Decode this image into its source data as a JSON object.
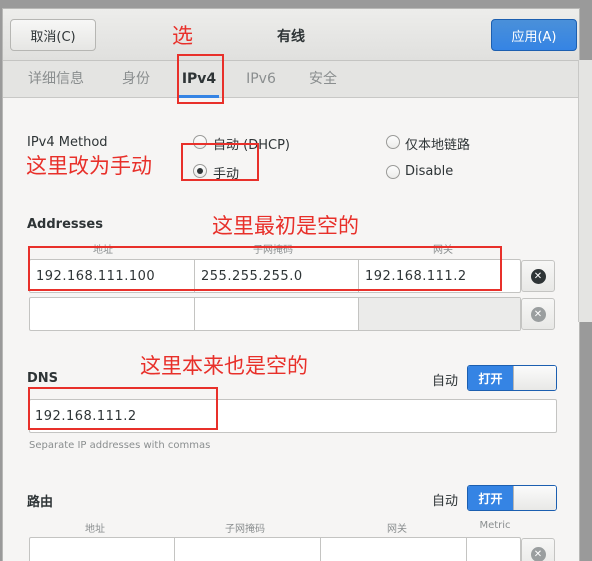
{
  "header": {
    "cancel_label": "取消(C)",
    "title": "有线",
    "apply_label": "应用(A)"
  },
  "tabs": [
    {
      "label": "详细信息"
    },
    {
      "label": "身份"
    },
    {
      "label": "IPv4"
    },
    {
      "label": "IPv6"
    },
    {
      "label": "安全"
    }
  ],
  "ipv4_method": {
    "label": "IPv4 Method",
    "options": [
      {
        "label": "自动 (DHCP)",
        "selected": false
      },
      {
        "label": "仅本地链路",
        "selected": false
      },
      {
        "label": "手动",
        "selected": true
      },
      {
        "label": "Disable",
        "selected": false
      }
    ]
  },
  "addresses": {
    "label": "Addresses",
    "columns": [
      "地址",
      "子网掩码",
      "网关"
    ],
    "rows": [
      {
        "address": "192.168.111.100",
        "netmask": "255.255.255.0",
        "gateway": "192.168.111.2"
      },
      {
        "address": "",
        "netmask": "",
        "gateway": ""
      }
    ]
  },
  "dns": {
    "label": "DNS",
    "auto_label": "自动",
    "toggle_label": "打开",
    "value": "192.168.111.2",
    "hint": "Separate IP addresses with commas"
  },
  "routes": {
    "label": "路由",
    "auto_label": "自动",
    "toggle_label": "打开",
    "columns": [
      "地址",
      "子网掩码",
      "网关",
      "Metric"
    ]
  },
  "annotations": {
    "select_tab": "选",
    "change_to_manual": "这里改为手动",
    "initially_empty": "这里最初是空的",
    "originally_empty": "这里本来也是空的"
  },
  "colors": {
    "accent": "#3584e4",
    "annotation_red": "#e8302a"
  }
}
